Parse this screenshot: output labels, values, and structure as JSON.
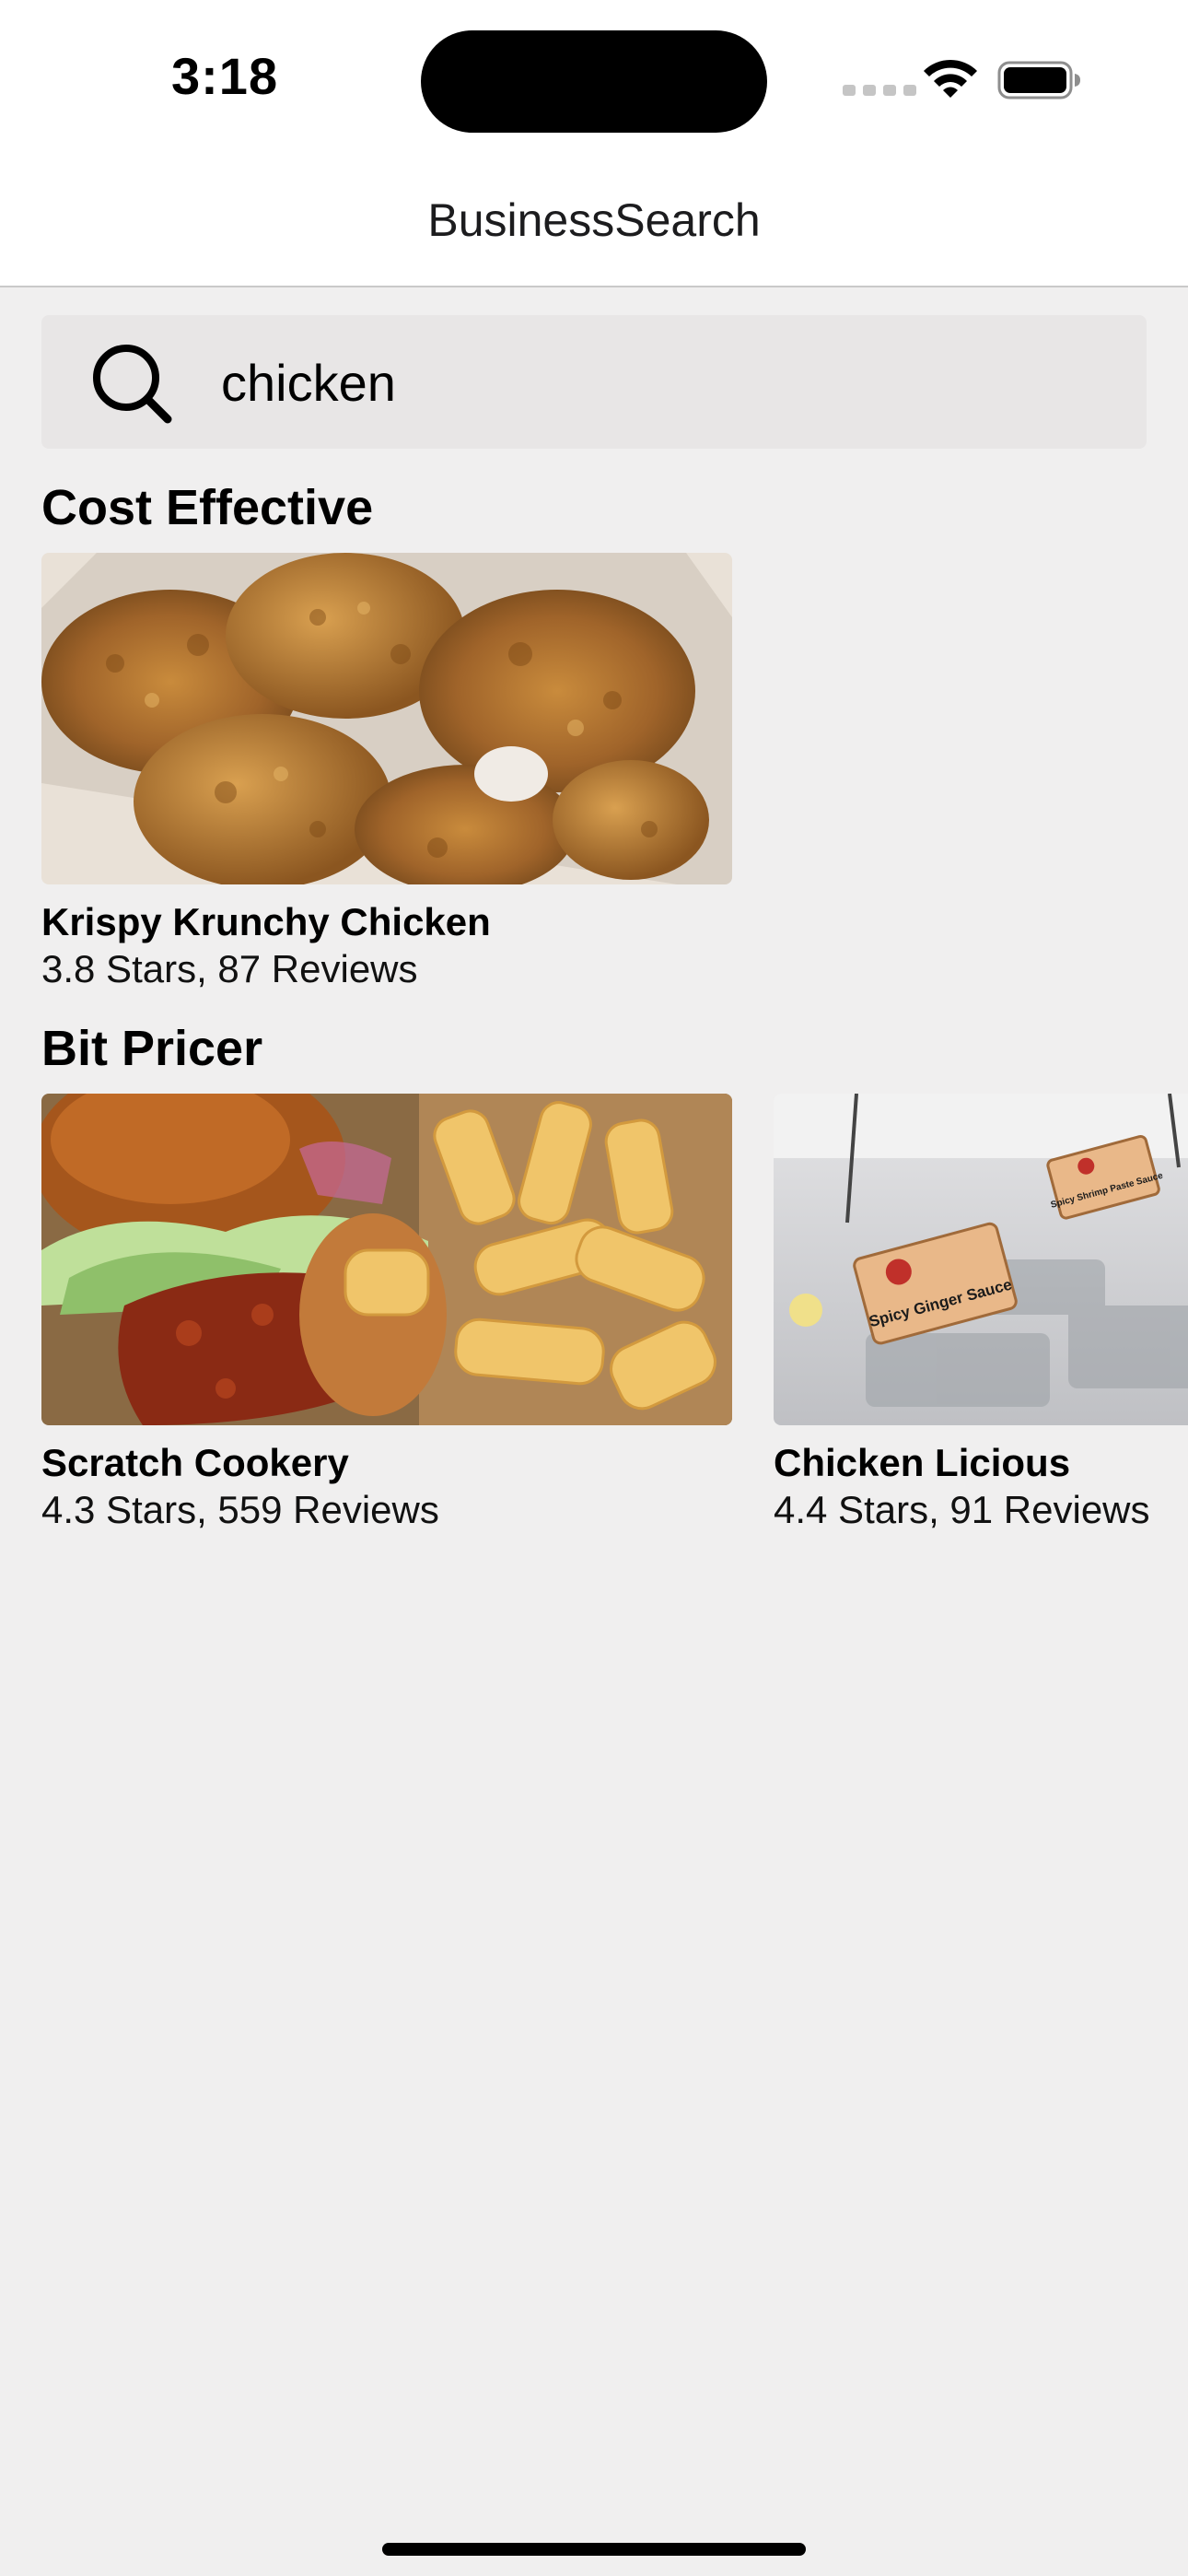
{
  "status_bar": {
    "time": "3:18"
  },
  "nav": {
    "title": "BusinessSearch"
  },
  "search": {
    "value": "chicken",
    "placeholder": "Search",
    "icon": "search-icon"
  },
  "sections": [
    {
      "title": "Cost Effective",
      "businesses": [
        {
          "name": "Krispy Krunchy Chicken",
          "meta": "3.8 Stars, 87 Reviews",
          "image": "fried-chicken-photo"
        }
      ]
    },
    {
      "title": "Bit Pricer",
      "businesses": [
        {
          "name": "Scratch Cookery",
          "meta": "4.3 Stars, 559 Reviews",
          "image": "chicken-sandwich-fries-photo"
        },
        {
          "name": "Chicken Licious",
          "meta": "4.4 Stars, 91 Reviews",
          "image": "sauce-bar-photo",
          "sign_text_1": "Spicy Ginger Sauce",
          "sign_text_2": "Spicy Shrimp Paste Sauce"
        }
      ]
    }
  ],
  "colors": {
    "background": "#f0efef",
    "search_background": "#e8e6e6",
    "nav_background": "#ffffff"
  }
}
